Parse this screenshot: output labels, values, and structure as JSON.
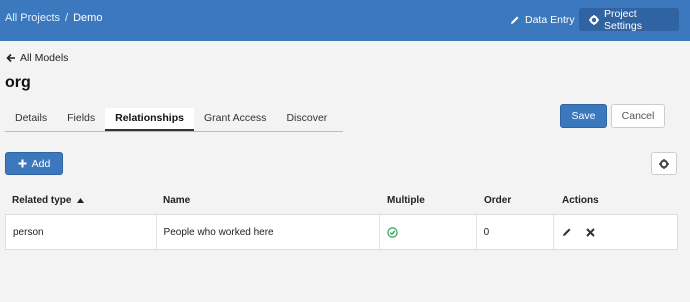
{
  "topbar": {
    "breadcrumb": {
      "root": "All Projects",
      "separator": "/",
      "current": "Demo"
    },
    "data_entry_label": "Data Entry",
    "project_settings_label": "Project Settings"
  },
  "back_label": "All Models",
  "model_name": "org",
  "tabs": [
    {
      "label": "Details"
    },
    {
      "label": "Fields"
    },
    {
      "label": "Relationships"
    },
    {
      "label": "Grant Access"
    },
    {
      "label": "Discover"
    }
  ],
  "active_tab": "Relationships",
  "buttons": {
    "save": "Save",
    "cancel": "Cancel",
    "add": "Add"
  },
  "table": {
    "headers": [
      "Related type",
      "Name",
      "Multiple",
      "Order",
      "Actions"
    ],
    "sort_column": "Related type",
    "rows": [
      {
        "related_type": "person",
        "name": "People who worked here",
        "multiple": true,
        "order": "0"
      }
    ]
  },
  "colors": {
    "primary": "#3b78bd",
    "topbar": "#3b78bd",
    "check": "#2e9e4f"
  },
  "icons": [
    "pencil-icon",
    "gear-icon",
    "arrow-left-icon",
    "plus-icon",
    "sort-up-icon",
    "check-circle-icon",
    "edit-icon",
    "delete-icon"
  ]
}
